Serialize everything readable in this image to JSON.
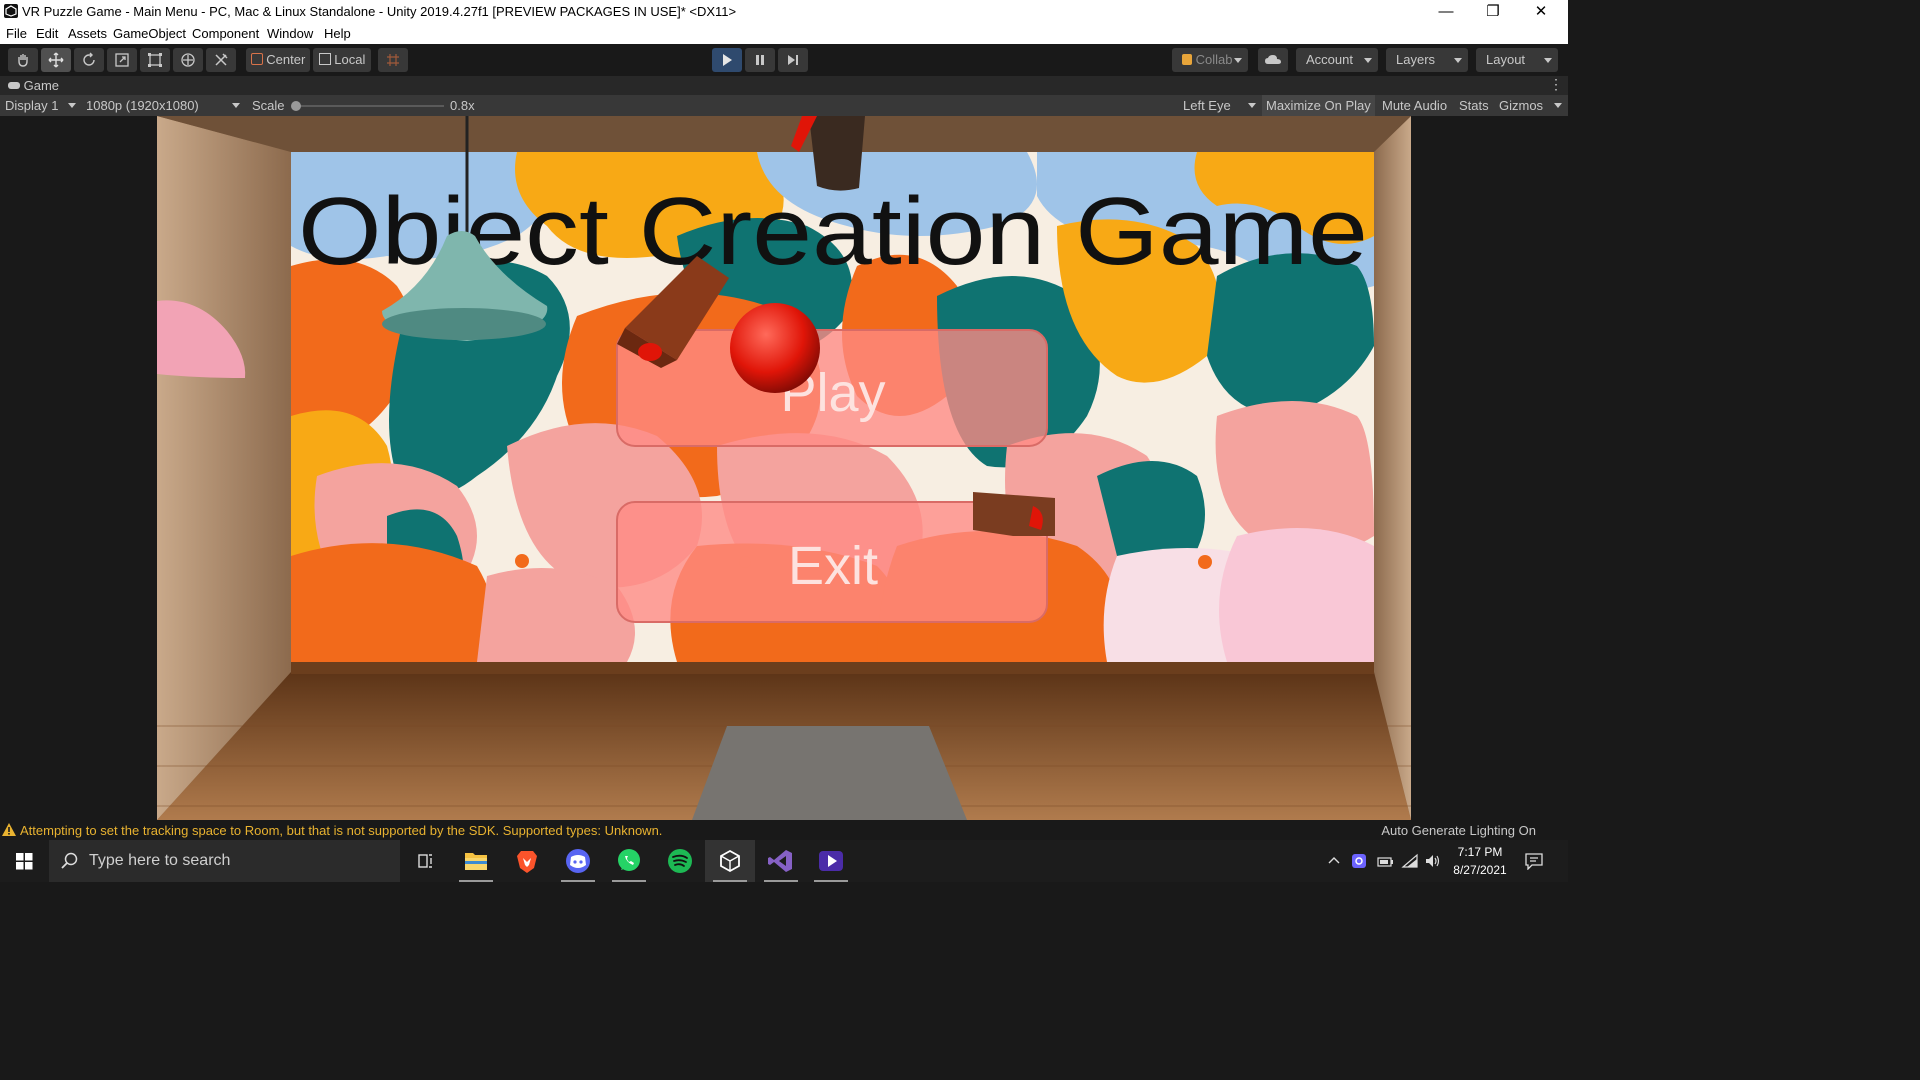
{
  "window": {
    "title": "VR Puzzle Game - Main Menu - PC, Mac & Linux Standalone - Unity 2019.4.27f1 [PREVIEW PACKAGES IN USE]* <DX11>",
    "controls": [
      "minimize-icon",
      "restore-icon",
      "close-icon"
    ]
  },
  "menu": [
    "File",
    "Edit",
    "Assets",
    "GameObject",
    "Component",
    "Window",
    "Help"
  ],
  "toolbar": {
    "tools": [
      "hand-icon",
      "move-icon",
      "rotate-icon",
      "scale-icon",
      "rect-icon",
      "transform-icon",
      "custom-tool-icon"
    ],
    "pivot_label": "Center",
    "space_label": "Local",
    "collab_label": "Collab",
    "account_label": "Account",
    "layers_label": "Layers",
    "layout_label": "Layout"
  },
  "game_tab": {
    "label": "Game"
  },
  "game_options": {
    "display": "Display 1",
    "resolution": "1080p (1920x1080)",
    "scale_label": "Scale",
    "scale_value": "0.8x",
    "scale_fraction": 0.0,
    "eye": "Left Eye",
    "maximize": "Maximize On Play",
    "mute": "Mute Audio",
    "stats": "Stats",
    "gizmos": "Gizmos"
  },
  "scene": {
    "heading": "Object Creation Game",
    "play_label": "Play",
    "exit_label": "Exit",
    "colors": {
      "teal": "#0f7371",
      "orange": "#f26a1b",
      "yellow": "#f8a915",
      "sky": "#9fc4e8",
      "pink": "#f4a39e",
      "cream": "#f7eee2"
    }
  },
  "status": {
    "warning": "Attempting to set the tracking space to Room, but that is not supported by the SDK. Supported types: Unknown.",
    "right": "Auto Generate Lighting On"
  },
  "taskbar": {
    "search_placeholder": "Type here to search",
    "apps": [
      "task-view-icon",
      "file-explorer-icon",
      "brave-icon",
      "discord-icon",
      "whatsapp-icon",
      "spotify-icon",
      "unity-icon",
      "visual-studio-icon",
      "video-editor-icon"
    ],
    "time": "7:17 PM",
    "date": "8/27/2021"
  }
}
